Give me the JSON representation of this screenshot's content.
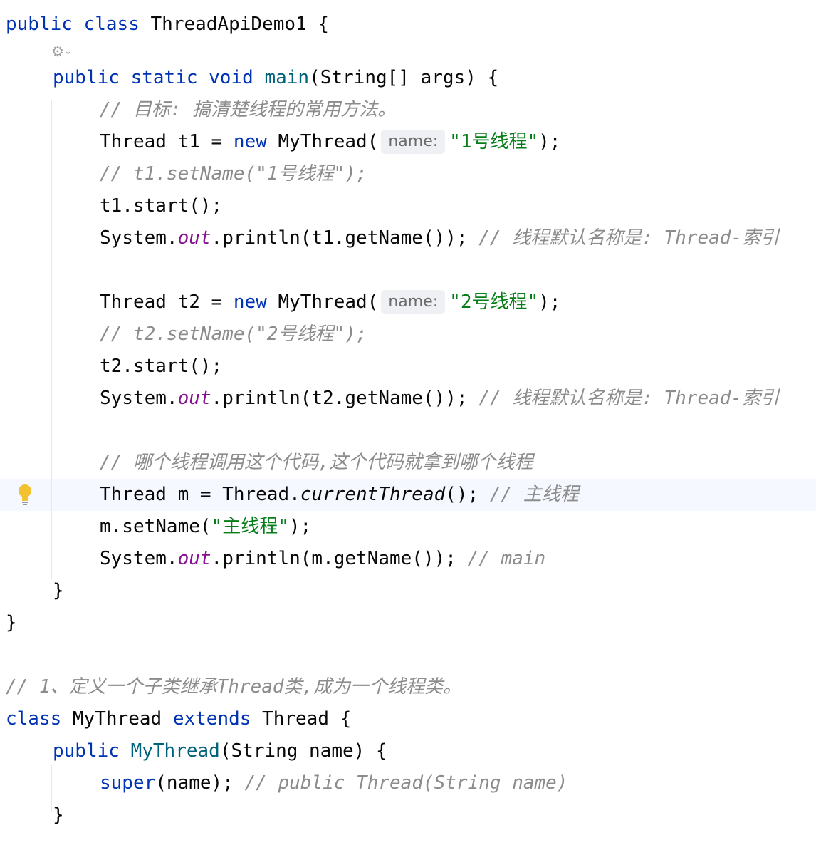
{
  "editor": {
    "language": "Java",
    "theme_colors": {
      "keyword": "#0033b3",
      "method_decl": "#00627a",
      "string": "#067d17",
      "comment": "#8c8c8c",
      "static_field": "#871094",
      "current_line": "#f5f8fe"
    },
    "icons": {
      "implement_marker": "implement-gutter-icon",
      "intention_bulb": "lightbulb-icon"
    },
    "code": {
      "l1": {
        "public": "public",
        "class": "class",
        "rest": " ThreadApiDemo1 {"
      },
      "l2": {
        "public": "public",
        "static": "static",
        "void": "void",
        "main": "main",
        "rest": "(String[] args) {"
      },
      "l3": {
        "comment": "// 目标: 搞清楚线程的常用方法。"
      },
      "l4": {
        "a": "Thread t1 = ",
        "new": "new",
        "b": " MyThread(",
        "hint": "name:",
        "str": "\"1号线程\"",
        "c": ");"
      },
      "l5": {
        "comment": "// t1.setName(\"1号线程\");"
      },
      "l6": {
        "text": "t1.start();"
      },
      "l7": {
        "a": "System.",
        "out": "out",
        "b": ".println(t1.getName()); ",
        "comment": "// 线程默认名称是: Thread-索引"
      },
      "l9": {
        "a": "Thread t2 = ",
        "new": "new",
        "b": " MyThread(",
        "hint": "name:",
        "str": "\"2号线程\"",
        "c": ");"
      },
      "l10": {
        "comment": "// t2.setName(\"2号线程\");"
      },
      "l11": {
        "text": "t2.start();"
      },
      "l12": {
        "a": "System.",
        "out": "out",
        "b": ".println(t2.getName()); ",
        "comment": "// 线程默认名称是: Thread-索引"
      },
      "l14": {
        "comment": "// 哪个线程调用这个代码,这个代码就拿到哪个线程"
      },
      "l15": {
        "a": "Thread m = Thread.",
        "method": "currentThread",
        "b": "(); ",
        "comment": "// 主线程"
      },
      "l16": {
        "a": "m.setName(",
        "str": "\"主线程\"",
        "b": ");"
      },
      "l17": {
        "a": "System.",
        "out": "out",
        "b": ".println(m.getName()); ",
        "comment": "// main"
      },
      "l18": {
        "text": "}"
      },
      "l19": {
        "text": "}"
      },
      "l21": {
        "comment": "// 1、定义一个子类继承Thread类,成为一个线程类。"
      },
      "l22": {
        "class": "class",
        "a": " MyThread ",
        "extends": "extends",
        "b": " Thread {"
      },
      "l23": {
        "public": "public",
        "ctor": "MyThread",
        "rest": "(String name) {"
      },
      "l24": {
        "super": "super",
        "a": "(name); ",
        "comment": "// public Thread(String name)"
      },
      "l25": {
        "text": "}"
      }
    }
  }
}
